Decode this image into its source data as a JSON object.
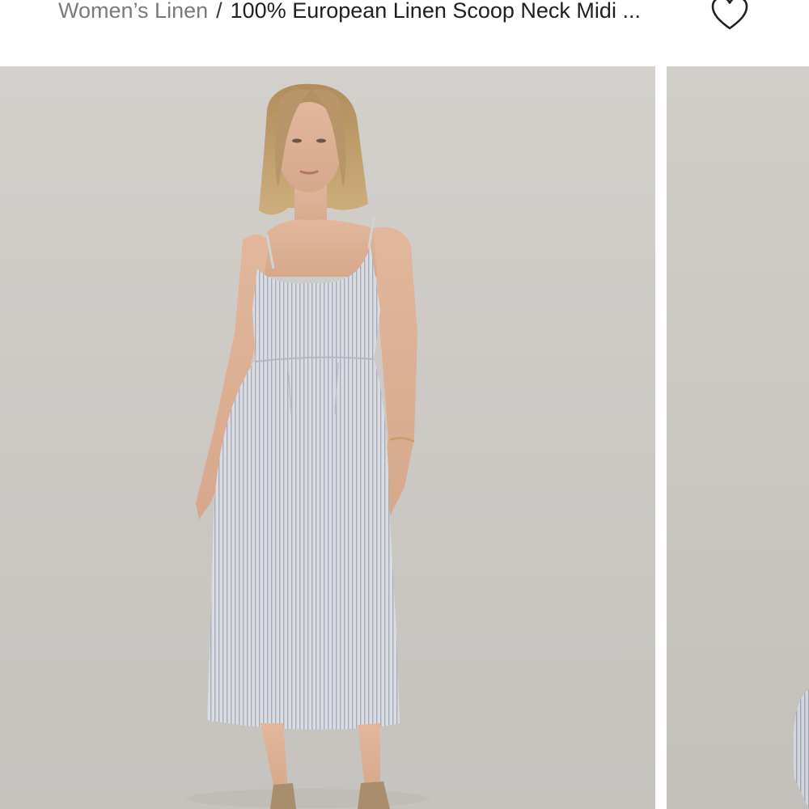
{
  "breadcrumb": {
    "parent_label": "Women’s Linen",
    "separator": "/",
    "current_label": "100% European Linen Scoop Neck Midi ..."
  },
  "favorite": {
    "icon": "heart-outline-icon",
    "color": "#1f1f1f"
  },
  "gallery": {
    "images": [
      {
        "subject": "model-wearing-striped-linen-midi-dress-front"
      },
      {
        "subject": "striped-linen-midi-dress-partial"
      }
    ]
  }
}
